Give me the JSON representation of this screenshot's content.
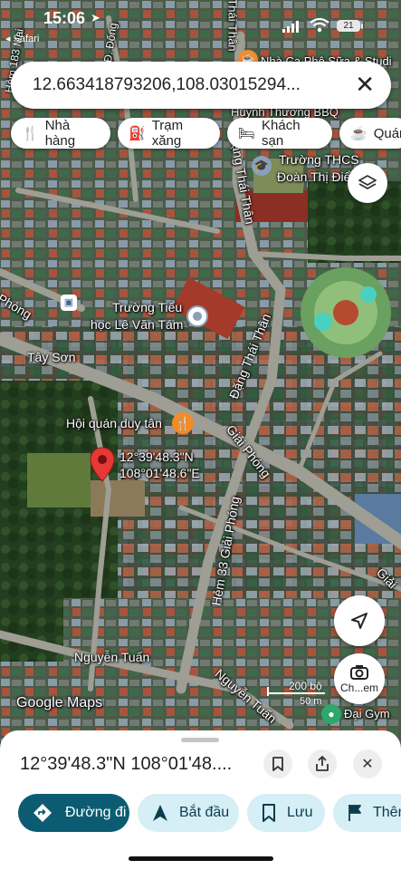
{
  "status": {
    "time": "15:06",
    "back_label": "◂ Safari",
    "battery": "21"
  },
  "search": {
    "value": "12.663418793206,108.03015294...",
    "clear_icon": "close-icon"
  },
  "chips": [
    {
      "icon": "restaurant-icon",
      "label": "Nhà hàng"
    },
    {
      "icon": "gas-station-icon",
      "label": "Trạm xăng"
    },
    {
      "icon": "hotel-icon",
      "label": "Khách sạn"
    },
    {
      "icon": "coffee-icon",
      "label": "Quán"
    }
  ],
  "map": {
    "streets": [
      "Hẻm 183 Mai",
      "Đ. Đống",
      "Thái Thân",
      "Phòng",
      "Tây Sơn",
      "Đặng Thái Thân",
      "Đặng Thái Thân",
      "Giải Phóng",
      "Hẻm 33 Giải Phóng",
      "Nguyễn Tuấn",
      "Nguyễn Tuấn",
      "Giải"
    ],
    "places": [
      "Nhà Ca Phê Sữa & Studi",
      "Huỳnh Thương BBQ",
      "Trường THCS",
      "Đoàn Thị Điể",
      "Trường Tiểu",
      "học Lê Văn Tám",
      "Hội quán duy tân",
      "Đại Gym"
    ],
    "pin_label": [
      "12°39'48.3\"N",
      "108°01'48.6\"E"
    ],
    "scale": {
      "label1": "200 bộ",
      "label2": "50 m"
    },
    "watermark": "Google Maps",
    "camera_label": "Ch...em"
  },
  "sheet": {
    "title": "12°39'48.3\"N 108°01'48....",
    "actions": [
      {
        "icon": "directions-icon",
        "label": "Đường đi",
        "primary": true
      },
      {
        "icon": "navigation-arrow-icon",
        "label": "Bắt đầu",
        "primary": false
      },
      {
        "icon": "bookmark-icon",
        "label": "Lưu",
        "primary": false
      },
      {
        "icon": "flag-icon",
        "label": "Thêm",
        "primary": false
      }
    ]
  },
  "colors": {
    "primary": "#0b5c72",
    "secondary": "#d6eef6",
    "pin": "#e53935",
    "food": "#f28c28"
  }
}
